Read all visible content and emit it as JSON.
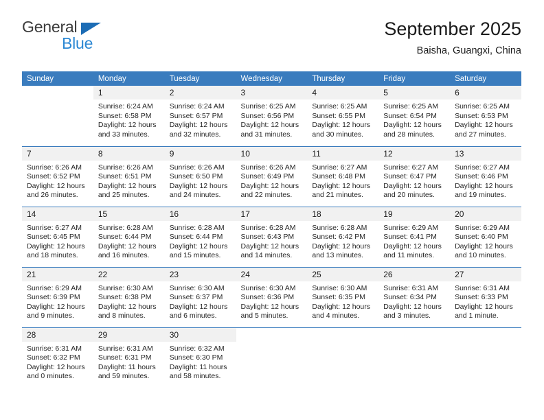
{
  "brand": {
    "name_part1": "General",
    "name_part2": "Blue",
    "color_dark": "#3b3b3b",
    "color_blue": "#2b87d3"
  },
  "header": {
    "title": "September 2025",
    "subtitle": "Baisha, Guangxi, China"
  },
  "theme": {
    "header_bg": "#3a7cbe",
    "daynum_bg": "#f1f1f1",
    "row_divider": "#3a7cbe"
  },
  "weekdays": [
    "Sunday",
    "Monday",
    "Tuesday",
    "Wednesday",
    "Thursday",
    "Friday",
    "Saturday"
  ],
  "weeks": [
    [
      {
        "day": "",
        "lines": []
      },
      {
        "day": "1",
        "lines": [
          "Sunrise: 6:24 AM",
          "Sunset: 6:58 PM",
          "Daylight: 12 hours",
          "and 33 minutes."
        ]
      },
      {
        "day": "2",
        "lines": [
          "Sunrise: 6:24 AM",
          "Sunset: 6:57 PM",
          "Daylight: 12 hours",
          "and 32 minutes."
        ]
      },
      {
        "day": "3",
        "lines": [
          "Sunrise: 6:25 AM",
          "Sunset: 6:56 PM",
          "Daylight: 12 hours",
          "and 31 minutes."
        ]
      },
      {
        "day": "4",
        "lines": [
          "Sunrise: 6:25 AM",
          "Sunset: 6:55 PM",
          "Daylight: 12 hours",
          "and 30 minutes."
        ]
      },
      {
        "day": "5",
        "lines": [
          "Sunrise: 6:25 AM",
          "Sunset: 6:54 PM",
          "Daylight: 12 hours",
          "and 28 minutes."
        ]
      },
      {
        "day": "6",
        "lines": [
          "Sunrise: 6:25 AM",
          "Sunset: 6:53 PM",
          "Daylight: 12 hours",
          "and 27 minutes."
        ]
      }
    ],
    [
      {
        "day": "7",
        "lines": [
          "Sunrise: 6:26 AM",
          "Sunset: 6:52 PM",
          "Daylight: 12 hours",
          "and 26 minutes."
        ]
      },
      {
        "day": "8",
        "lines": [
          "Sunrise: 6:26 AM",
          "Sunset: 6:51 PM",
          "Daylight: 12 hours",
          "and 25 minutes."
        ]
      },
      {
        "day": "9",
        "lines": [
          "Sunrise: 6:26 AM",
          "Sunset: 6:50 PM",
          "Daylight: 12 hours",
          "and 24 minutes."
        ]
      },
      {
        "day": "10",
        "lines": [
          "Sunrise: 6:26 AM",
          "Sunset: 6:49 PM",
          "Daylight: 12 hours",
          "and 22 minutes."
        ]
      },
      {
        "day": "11",
        "lines": [
          "Sunrise: 6:27 AM",
          "Sunset: 6:48 PM",
          "Daylight: 12 hours",
          "and 21 minutes."
        ]
      },
      {
        "day": "12",
        "lines": [
          "Sunrise: 6:27 AM",
          "Sunset: 6:47 PM",
          "Daylight: 12 hours",
          "and 20 minutes."
        ]
      },
      {
        "day": "13",
        "lines": [
          "Sunrise: 6:27 AM",
          "Sunset: 6:46 PM",
          "Daylight: 12 hours",
          "and 19 minutes."
        ]
      }
    ],
    [
      {
        "day": "14",
        "lines": [
          "Sunrise: 6:27 AM",
          "Sunset: 6:45 PM",
          "Daylight: 12 hours",
          "and 18 minutes."
        ]
      },
      {
        "day": "15",
        "lines": [
          "Sunrise: 6:28 AM",
          "Sunset: 6:44 PM",
          "Daylight: 12 hours",
          "and 16 minutes."
        ]
      },
      {
        "day": "16",
        "lines": [
          "Sunrise: 6:28 AM",
          "Sunset: 6:44 PM",
          "Daylight: 12 hours",
          "and 15 minutes."
        ]
      },
      {
        "day": "17",
        "lines": [
          "Sunrise: 6:28 AM",
          "Sunset: 6:43 PM",
          "Daylight: 12 hours",
          "and 14 minutes."
        ]
      },
      {
        "day": "18",
        "lines": [
          "Sunrise: 6:28 AM",
          "Sunset: 6:42 PM",
          "Daylight: 12 hours",
          "and 13 minutes."
        ]
      },
      {
        "day": "19",
        "lines": [
          "Sunrise: 6:29 AM",
          "Sunset: 6:41 PM",
          "Daylight: 12 hours",
          "and 11 minutes."
        ]
      },
      {
        "day": "20",
        "lines": [
          "Sunrise: 6:29 AM",
          "Sunset: 6:40 PM",
          "Daylight: 12 hours",
          "and 10 minutes."
        ]
      }
    ],
    [
      {
        "day": "21",
        "lines": [
          "Sunrise: 6:29 AM",
          "Sunset: 6:39 PM",
          "Daylight: 12 hours",
          "and 9 minutes."
        ]
      },
      {
        "day": "22",
        "lines": [
          "Sunrise: 6:30 AM",
          "Sunset: 6:38 PM",
          "Daylight: 12 hours",
          "and 8 minutes."
        ]
      },
      {
        "day": "23",
        "lines": [
          "Sunrise: 6:30 AM",
          "Sunset: 6:37 PM",
          "Daylight: 12 hours",
          "and 6 minutes."
        ]
      },
      {
        "day": "24",
        "lines": [
          "Sunrise: 6:30 AM",
          "Sunset: 6:36 PM",
          "Daylight: 12 hours",
          "and 5 minutes."
        ]
      },
      {
        "day": "25",
        "lines": [
          "Sunrise: 6:30 AM",
          "Sunset: 6:35 PM",
          "Daylight: 12 hours",
          "and 4 minutes."
        ]
      },
      {
        "day": "26",
        "lines": [
          "Sunrise: 6:31 AM",
          "Sunset: 6:34 PM",
          "Daylight: 12 hours",
          "and 3 minutes."
        ]
      },
      {
        "day": "27",
        "lines": [
          "Sunrise: 6:31 AM",
          "Sunset: 6:33 PM",
          "Daylight: 12 hours",
          "and 1 minute."
        ]
      }
    ],
    [
      {
        "day": "28",
        "lines": [
          "Sunrise: 6:31 AM",
          "Sunset: 6:32 PM",
          "Daylight: 12 hours",
          "and 0 minutes."
        ]
      },
      {
        "day": "29",
        "lines": [
          "Sunrise: 6:31 AM",
          "Sunset: 6:31 PM",
          "Daylight: 11 hours",
          "and 59 minutes."
        ]
      },
      {
        "day": "30",
        "lines": [
          "Sunrise: 6:32 AM",
          "Sunset: 6:30 PM",
          "Daylight: 11 hours",
          "and 58 minutes."
        ]
      },
      {
        "day": "",
        "lines": []
      },
      {
        "day": "",
        "lines": []
      },
      {
        "day": "",
        "lines": []
      },
      {
        "day": "",
        "lines": []
      }
    ]
  ]
}
